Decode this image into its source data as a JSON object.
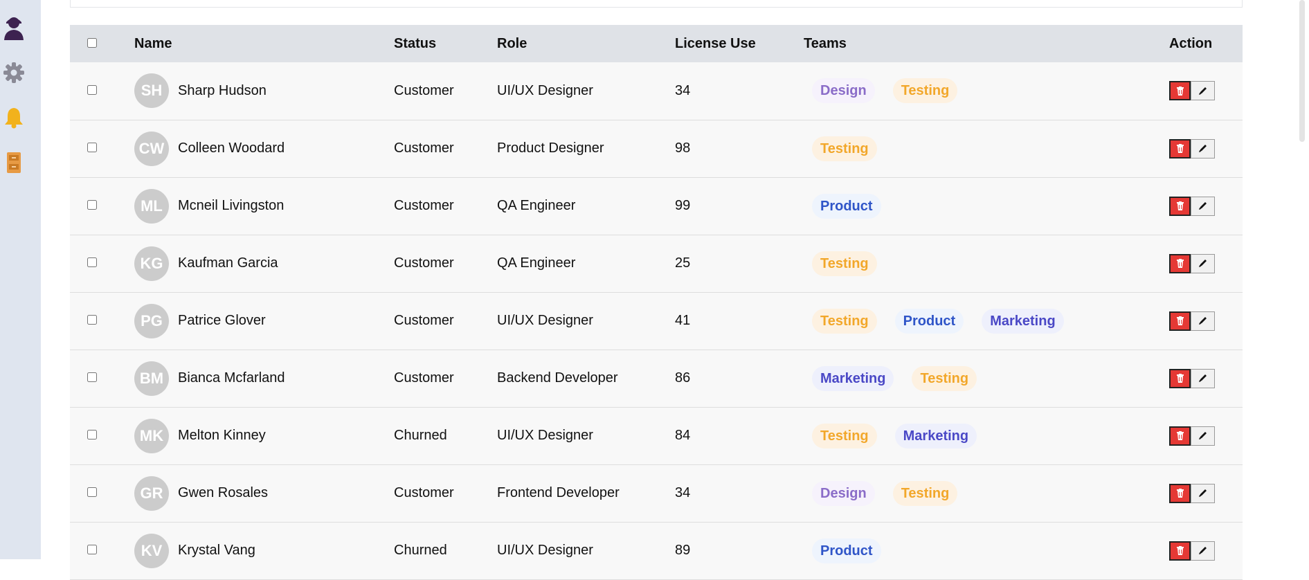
{
  "sidebar": {
    "icons": [
      {
        "name": "user-avatar-icon"
      },
      {
        "name": "gear-icon"
      },
      {
        "name": "bell-icon"
      },
      {
        "name": "cabinet-icon"
      }
    ]
  },
  "table": {
    "headers": {
      "name": "Name",
      "status": "Status",
      "role": "Role",
      "license": "License Use",
      "teams": "Teams",
      "action": "Action"
    },
    "rows": [
      {
        "initials": "SH",
        "name": "Sharp Hudson",
        "status": "Customer",
        "role": "UI/UX Designer",
        "license": "34",
        "teams": [
          "Design",
          "Testing"
        ]
      },
      {
        "initials": "CW",
        "name": "Colleen Woodard",
        "status": "Customer",
        "role": "Product Designer",
        "license": "98",
        "teams": [
          "Testing"
        ]
      },
      {
        "initials": "ML",
        "name": "Mcneil Livingston",
        "status": "Customer",
        "role": "QA Engineer",
        "license": "99",
        "teams": [
          "Product"
        ]
      },
      {
        "initials": "KG",
        "name": "Kaufman Garcia",
        "status": "Customer",
        "role": "QA Engineer",
        "license": "25",
        "teams": [
          "Testing"
        ]
      },
      {
        "initials": "PG",
        "name": "Patrice Glover",
        "status": "Customer",
        "role": "UI/UX Designer",
        "license": "41",
        "teams": [
          "Testing",
          "Product",
          "Marketing"
        ]
      },
      {
        "initials": "BM",
        "name": "Bianca Mcfarland",
        "status": "Customer",
        "role": "Backend Developer",
        "license": "86",
        "teams": [
          "Marketing",
          "Testing"
        ]
      },
      {
        "initials": "MK",
        "name": "Melton Kinney",
        "status": "Churned",
        "role": "UI/UX Designer",
        "license": "84",
        "teams": [
          "Testing",
          "Marketing"
        ]
      },
      {
        "initials": "GR",
        "name": "Gwen Rosales",
        "status": "Customer",
        "role": "Frontend Developer",
        "license": "34",
        "teams": [
          "Design",
          "Testing"
        ]
      },
      {
        "initials": "KV",
        "name": "Krystal Vang",
        "status": "Churned",
        "role": "UI/UX Designer",
        "license": "89",
        "teams": [
          "Product"
        ]
      }
    ]
  },
  "colors": {
    "sidebar_bg": "#dfe5ef",
    "header_bg": "#dfe2e7",
    "row_bg": "#f8f8f8",
    "delete_btn": "#e53935",
    "tag_design": "#8a6cc8",
    "tag_testing": "#f2a72a",
    "tag_product": "#2f55c8",
    "tag_marketing": "#4a48c6"
  }
}
